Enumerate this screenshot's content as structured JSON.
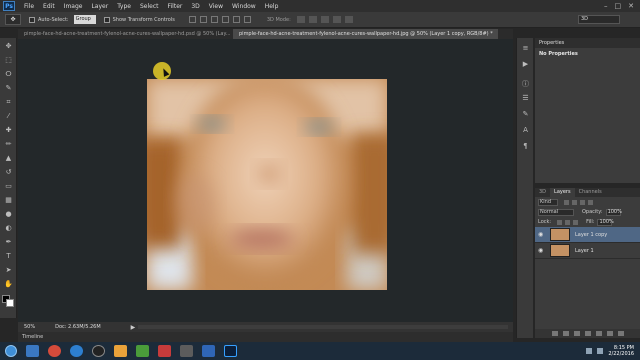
{
  "menubar": {
    "logo": "Ps",
    "items": [
      "File",
      "Edit",
      "Image",
      "Layer",
      "Type",
      "Select",
      "Filter",
      "3D",
      "View",
      "Window",
      "Help"
    ],
    "window_controls": [
      "–",
      "□",
      "✕"
    ]
  },
  "options": {
    "tool_glyph": "✥",
    "auto_select_label": "Auto-Select:",
    "auto_select_value": "Group",
    "transform_label": "Show Transform Controls",
    "mode3d_label": "3D Mode:",
    "workspace": "3D"
  },
  "tabs": [
    {
      "title": "pimple-face-hd-acne-treatment-fylenol-acne-cures-wallpaper-hd.psd @ 50% (Lay...",
      "close": "×"
    },
    {
      "title": "pimple-face-hd-acne-treatment-fylenol-acne-cures-wallpaper-hd.jpg @ 50% (Layer 1 copy, RGB/8#) *",
      "close": "×"
    }
  ],
  "status": {
    "zoom": "50%",
    "doc": "Doc: 2.63M/5.26M",
    "arrow": "▶"
  },
  "timeline_label": "Timeline",
  "properties": {
    "tab": "Properties",
    "body": "No Properties"
  },
  "layers": {
    "tabs": [
      "3D",
      "Layers",
      "Channels"
    ],
    "kind_label": "Kind",
    "blend_mode": "Normal",
    "opacity_label": "Opacity:",
    "opacity_value": "100%",
    "lock_label": "Lock:",
    "fill_label": "Fill:",
    "fill_value": "100%",
    "items": [
      {
        "name": "Layer 1 copy",
        "selected": true
      },
      {
        "name": "Layer 1",
        "selected": false
      }
    ]
  },
  "taskbar": {
    "time": "8:15 PM",
    "date": "2/22/2016"
  }
}
